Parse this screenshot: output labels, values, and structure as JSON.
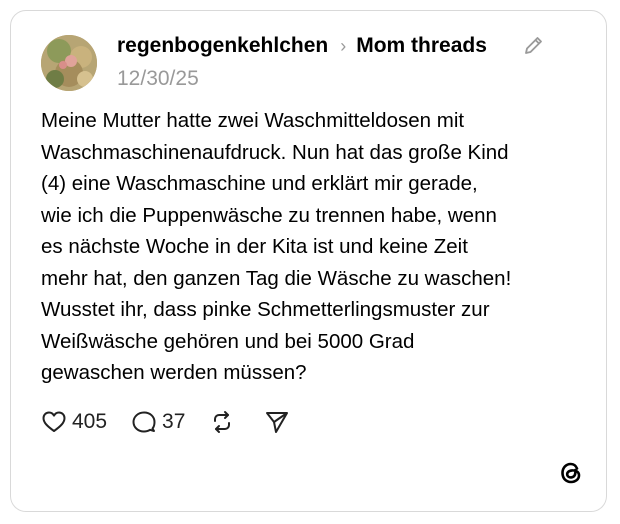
{
  "post": {
    "author": "regenbogenkehlchen",
    "breadcrumb_separator": "›",
    "community": "Mom threads",
    "date": "12/30/25",
    "text": "Meine Mutter hatte zwei Waschmitteldosen mit\nWaschmaschinenaufdruck. Nun hat das große Kind\n(4) eine Waschmaschine und erklärt mir gerade,\nwie ich die Puppenwäsche zu trennen habe, wenn\nes nächste Woche in der Kita ist und keine Zeit\nmehr hat, den ganzen Tag die Wäsche zu waschen!\nWusstet ihr, dass pinke Schmetterlingsmuster zur\nWeißwäsche gehören und bei 5000 Grad\ngewaschen werden müssen?",
    "like_count": "405",
    "reply_count": "37"
  },
  "icons": {
    "edit": "pencil-icon",
    "like": "heart-icon",
    "reply": "speech-bubble-icon",
    "repost": "repost-icon",
    "share": "send-icon",
    "brand": "threads-logo-icon"
  },
  "colors": {
    "text": "#000000",
    "muted": "#999999",
    "border": "#d9d9d9",
    "background": "#ffffff"
  }
}
